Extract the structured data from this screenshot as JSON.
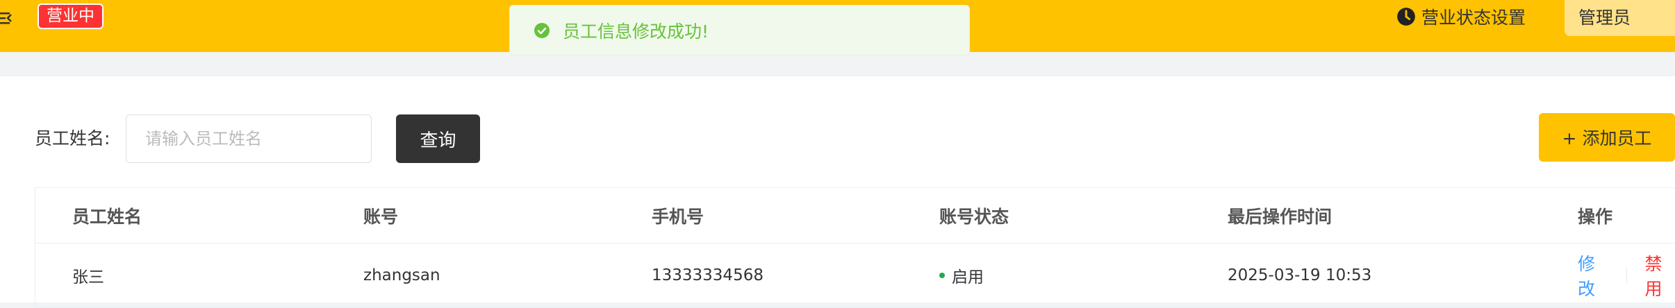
{
  "header": {
    "status_badge": "营业中",
    "status_settings_label": "营业状态设置",
    "admin_label": "管理员"
  },
  "toast": {
    "message": "员工信息修改成功!"
  },
  "filter": {
    "label": "员工姓名:",
    "placeholder": "请输入员工姓名",
    "query_label": "查询",
    "add_label": "+ 添加员工"
  },
  "table": {
    "columns": [
      "员工姓名",
      "账号",
      "手机号",
      "账号状态",
      "最后操作时间",
      "操作"
    ],
    "rows": [
      {
        "name": "张三",
        "account": "zhangsan",
        "phone": "13333334568",
        "status": "启用",
        "last_op_time": "2025-03-19 10:53",
        "edit_label": "修改",
        "disable_label": "禁用"
      }
    ]
  },
  "colors": {
    "brand": "#ffc200",
    "badge": "#fd3333",
    "success": "#67c23a",
    "link": "#419eff",
    "status_dot": "#22a94f"
  },
  "icons": [
    "menu-toggle-icon",
    "success-check-icon",
    "clock-icon"
  ]
}
